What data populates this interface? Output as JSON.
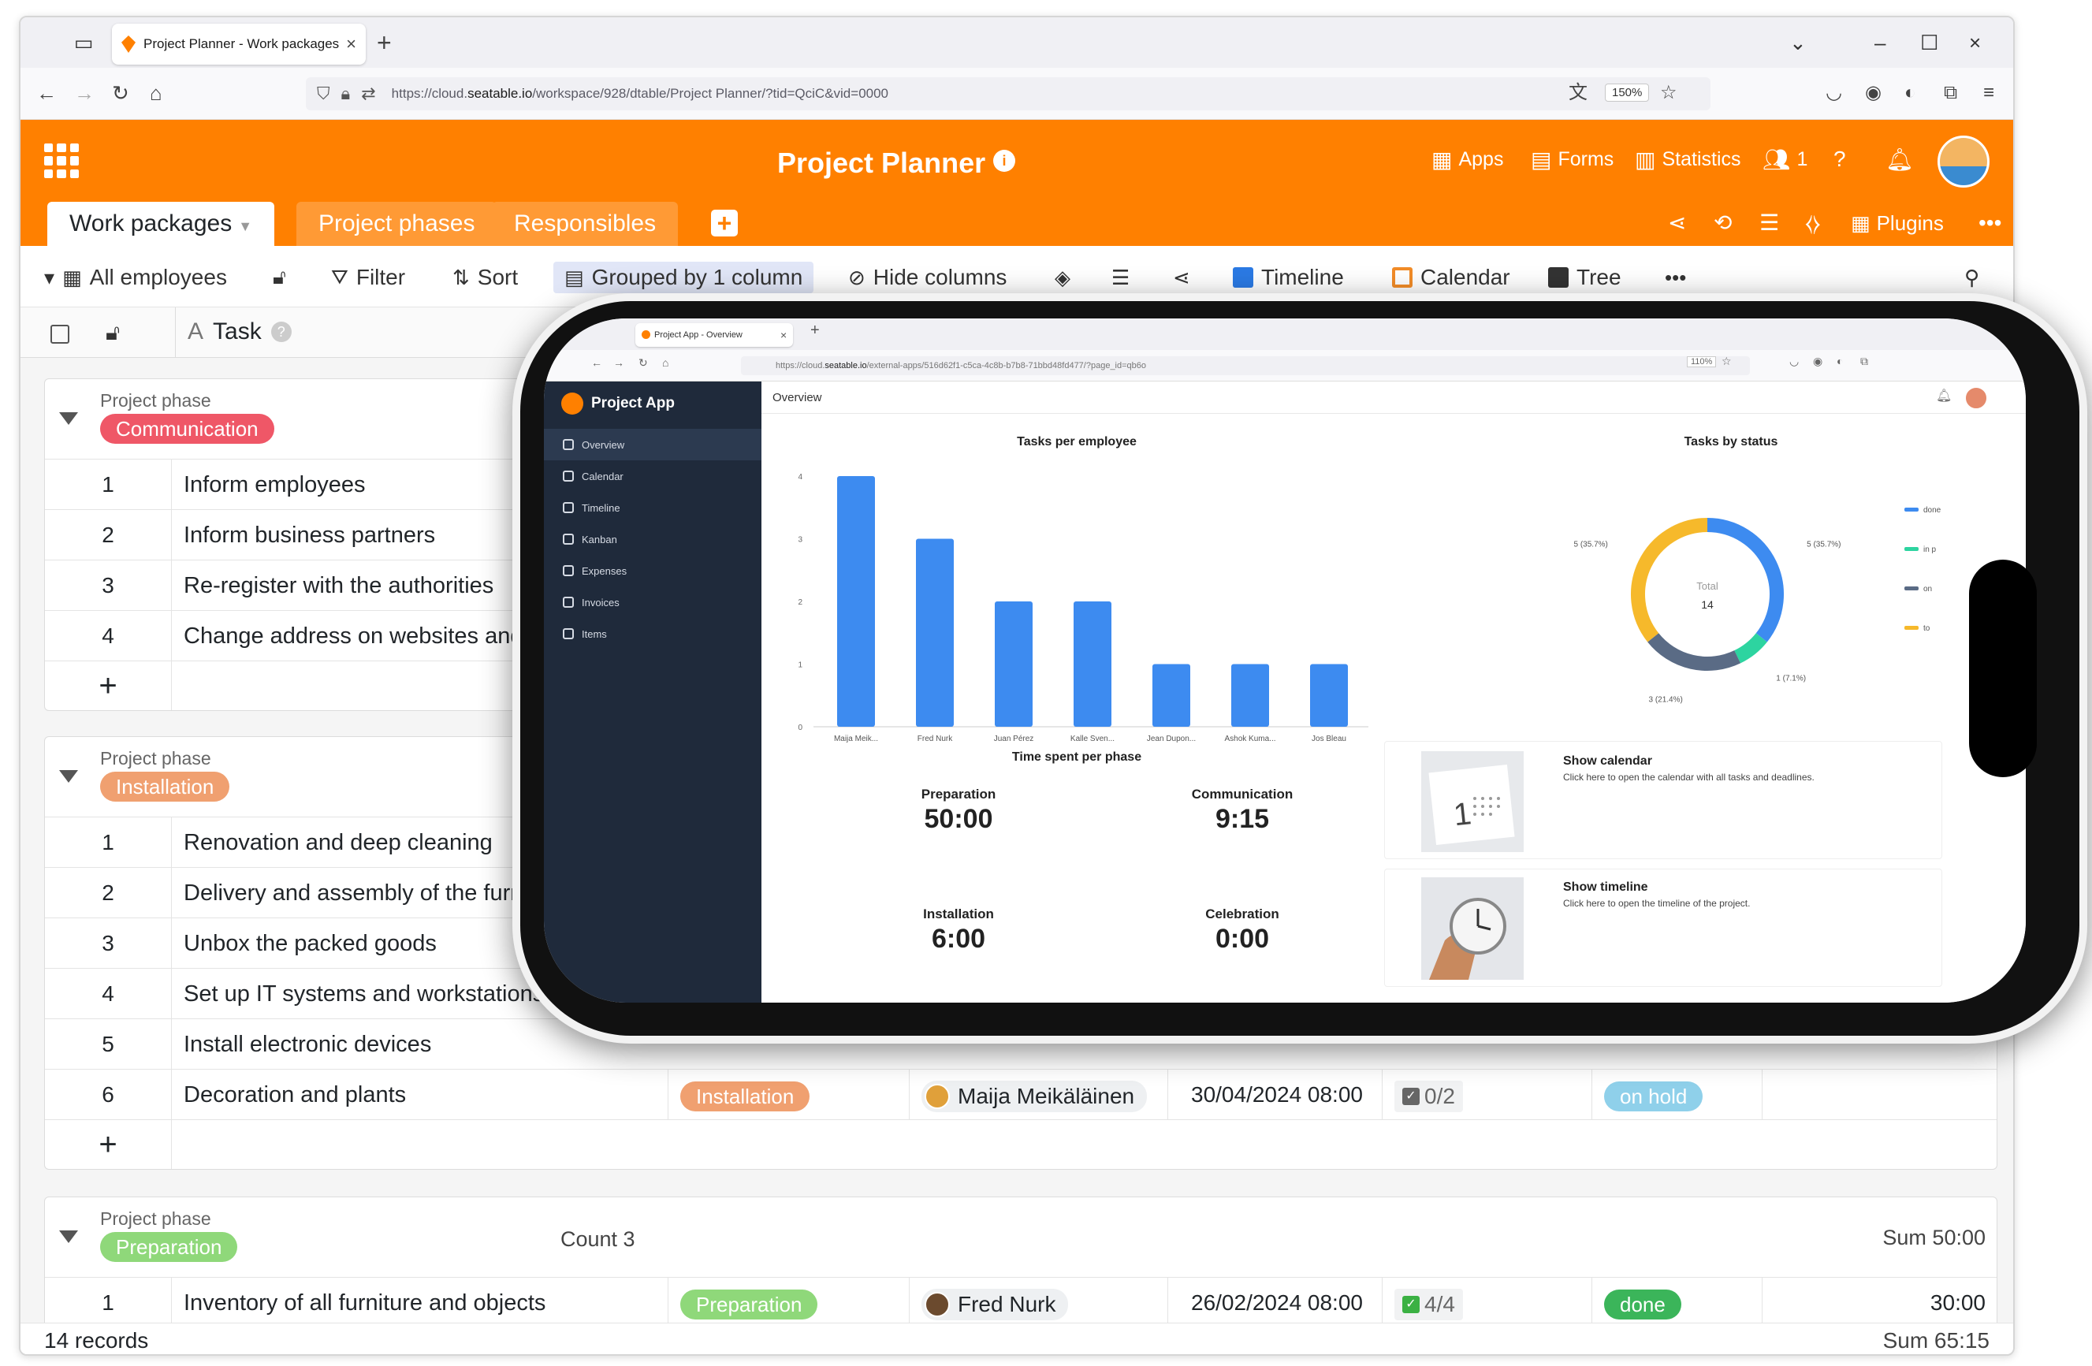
{
  "browser": {
    "tab_title": "Project Planner - Work packages",
    "url_prefix": "https://cloud.",
    "url_domain": "seatable.io",
    "url_rest": "/workspace/928/dtable/Project Planner/?tid=QciC&vid=0000",
    "zoom": "150%"
  },
  "header": {
    "title": "Project Planner",
    "apps": "Apps",
    "forms": "Forms",
    "statistics": "Statistics",
    "collaborators_count": "1",
    "plugins": "Plugins"
  },
  "tabs": [
    "Work packages",
    "Project phases",
    "Responsibles"
  ],
  "toolbar": {
    "view": "All employees",
    "filter": "Filter",
    "sort": "Sort",
    "grouped": "Grouped by 1 column",
    "hide": "Hide columns",
    "timeline": "Timeline",
    "calendar": "Calendar",
    "tree": "Tree"
  },
  "columns": {
    "task": "Task"
  },
  "groups": [
    {
      "label": "Project phase",
      "phase": "Communication",
      "color": "#ef5767",
      "rows": [
        {
          "n": "1",
          "task": "Inform employees"
        },
        {
          "n": "2",
          "task": "Inform business partners"
        },
        {
          "n": "3",
          "task": "Re-register with the authorities"
        },
        {
          "n": "4",
          "task": "Change address on websites and"
        }
      ]
    },
    {
      "label": "Project phase",
      "phase": "Installation",
      "color": "#f0a070",
      "rows": [
        {
          "n": "1",
          "task": "Renovation and deep cleaning"
        },
        {
          "n": "2",
          "task": "Delivery and assembly of the furn"
        },
        {
          "n": "3",
          "task": "Unbox the packed goods"
        },
        {
          "n": "4",
          "task": "Set up IT systems and workstations"
        },
        {
          "n": "5",
          "task": "Install electronic devices"
        },
        {
          "n": "6",
          "task": "Decoration and plants",
          "phase": "Installation",
          "person": "Maija Meikäläinen",
          "date": "30/04/2024 08:00",
          "check": "0/2",
          "status": "on hold",
          "status_color": "#8fd0ea"
        }
      ]
    },
    {
      "label": "Project phase",
      "phase": "Preparation",
      "color": "#8fd87a",
      "count": "Count 3",
      "sum": "Sum 50:00",
      "rows": [
        {
          "n": "1",
          "task": "Inventory of all furniture and objects",
          "phase": "Preparation",
          "person": "Fred Nurk",
          "date": "26/02/2024 08:00",
          "check": "4/4",
          "status": "done",
          "status_color": "#3bb55a",
          "duration": "30:00"
        }
      ]
    }
  ],
  "footer": {
    "records": "14 records",
    "sum": "Sum 65:15"
  },
  "phone": {
    "tab_title": "Project App - Overview",
    "url_prefix": "https://cloud.",
    "url_domain": "seatable.io",
    "url_rest": "/external-apps/516d62f1-c5ca-4c8b-b7b8-71bbd48fd477/?page_id=qb6o",
    "zoom": "110%",
    "app_name": "Project App",
    "page_title": "Overview",
    "nav": [
      "Overview",
      "Calendar",
      "Timeline",
      "Kanban",
      "Expenses",
      "Invoices",
      "Items"
    ],
    "kpi_title": "Time spent per phase",
    "kpis": [
      {
        "label": "Preparation",
        "value": "50:00"
      },
      {
        "label": "Communication",
        "value": "9:15"
      },
      {
        "label": "Installation",
        "value": "6:00"
      },
      {
        "label": "Celebration",
        "value": "0:00"
      }
    ],
    "cards": [
      {
        "title": "Show calendar",
        "text": "Click here to open the calendar with all tasks and deadlines."
      },
      {
        "title": "Show timeline",
        "text": "Click here to open the timeline of the project."
      }
    ]
  },
  "chart_data": [
    {
      "type": "bar",
      "title": "Tasks per employee",
      "categories": [
        "Maija Meik...",
        "Fred Nurk",
        "Juan Pérez",
        "Kalle Sven...",
        "Jean Dupon...",
        "Ashok Kuma...",
        "Jos Bleau"
      ],
      "values": [
        4,
        3,
        2,
        2,
        1,
        1,
        1
      ],
      "ylim": [
        0,
        4
      ],
      "yticks": [
        "0",
        "1",
        "2",
        "3",
        "4"
      ],
      "color": "#3d8bf0"
    },
    {
      "type": "pie",
      "title": "Tasks by status",
      "center_label": "Total",
      "center_value": "14",
      "slices": [
        {
          "name": "done",
          "value": 5,
          "label": "5 (35.7%)",
          "color": "#3d8bf0"
        },
        {
          "name": "in progress",
          "value": 1,
          "label": "1 (7.1%)",
          "color": "#2dd4a0"
        },
        {
          "name": "on hold",
          "value": 3,
          "label": "3 (21.4%)",
          "color": "#5a6b85"
        },
        {
          "name": "to do",
          "value": 5,
          "label": "5 (35.7%)",
          "color": "#f6b92b"
        }
      ],
      "legend": [
        "done",
        "in p",
        "on",
        "to"
      ]
    }
  ]
}
